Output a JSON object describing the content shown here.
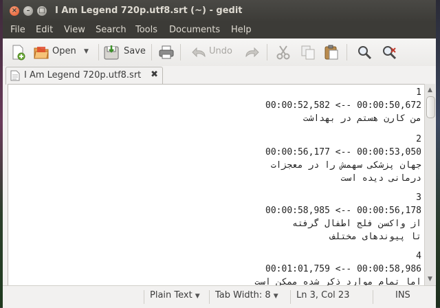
{
  "window": {
    "title": "I Am Legend 720p.utf8.srt (~) - gedit"
  },
  "menu": [
    "File",
    "Edit",
    "View",
    "Search",
    "Tools",
    "Documents",
    "Help"
  ],
  "toolbar": {
    "open_label": "Open",
    "save_label": "Save",
    "undo_label": "Undo"
  },
  "tab": {
    "label": "I Am Legend 720p.utf8.srt"
  },
  "document": {
    "lines": [
      "1",
      "00:00:50,672 --> 00:00:52,582",
      "من کارن هستم در بهداشت",
      "",
      "2",
      "00:00:53,050 --> 00:00:56,177",
      "جهان پزشکی سهمش را در معجزات",
      "درمانی دیده است",
      "",
      "3",
      "00:00:56,178 --> 00:00:58,985",
      "از واکسن فلج اطفال گرفته",
      "تا پیوندهای مختلف",
      "",
      "4",
      "00:00:58,986 --> 00:01:01,759",
      "اما تمام موارد ذکر شده ممکن است"
    ]
  },
  "status": {
    "language": "Plain Text",
    "tab_width": "Tab Width: 8",
    "position": "Ln 3, Col 23",
    "mode": "INS"
  },
  "colors": {
    "titlebar": "#3c3b37",
    "close_button": "#e2552b",
    "editor_bg": "#ffffff"
  }
}
